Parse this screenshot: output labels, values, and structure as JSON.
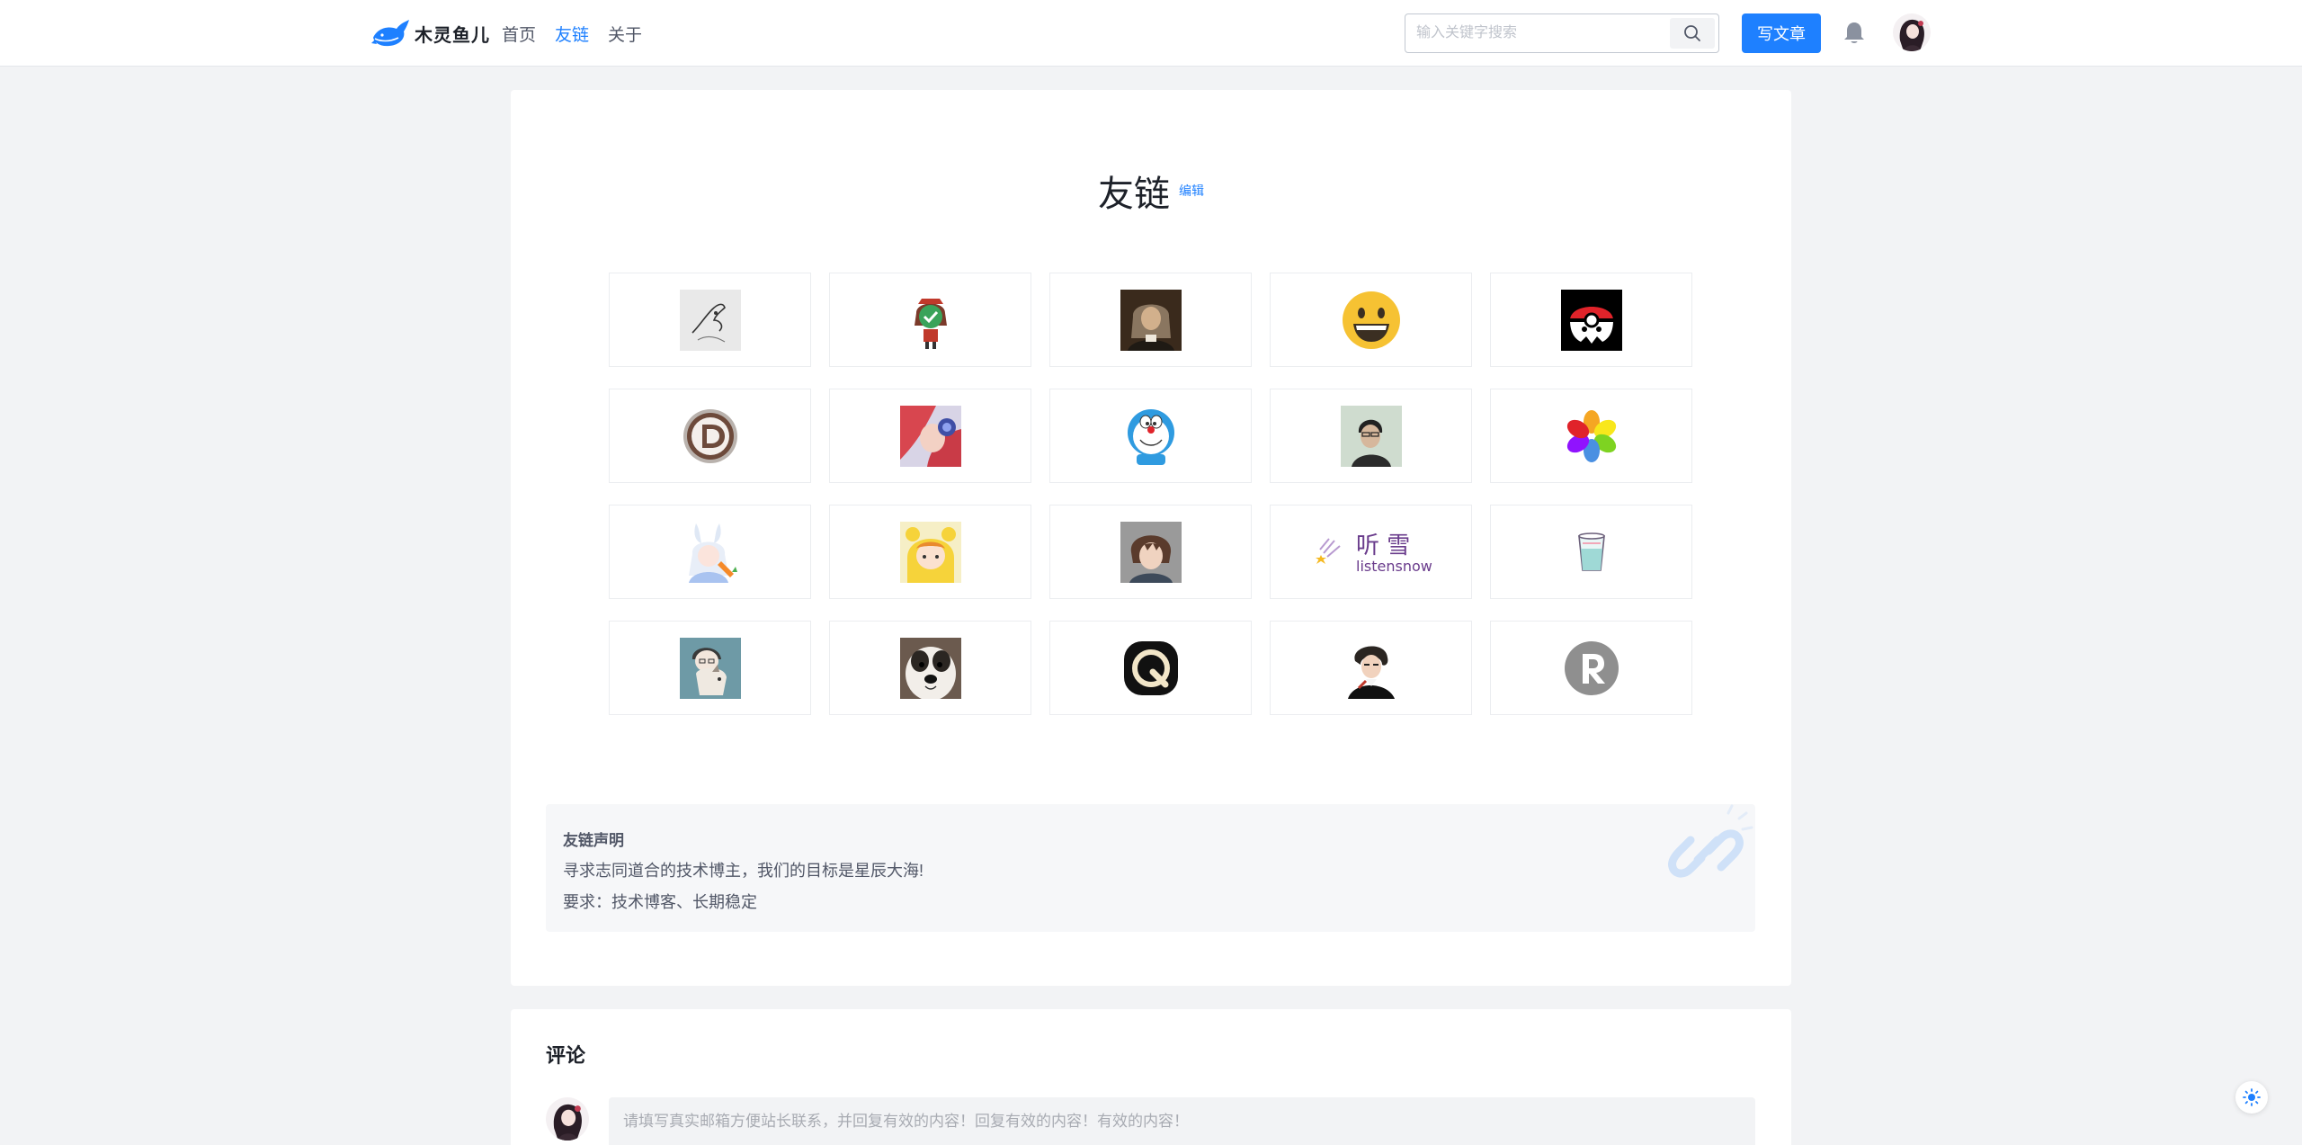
{
  "site": {
    "logo_text": "木灵鱼儿"
  },
  "nav": {
    "items": [
      "首页",
      "友链",
      "关于"
    ],
    "active_index": 1
  },
  "search": {
    "placeholder": "输入关键字搜索"
  },
  "header": {
    "write_label": "写文章"
  },
  "page": {
    "title": "友链",
    "edit_label": "编辑"
  },
  "friend_links": [
    {
      "icon": "sketch-avatar"
    },
    {
      "icon": "green-face-girl-avatar"
    },
    {
      "icon": "portrait-painting-avatar"
    },
    {
      "icon": "grinning-emoji-avatar"
    },
    {
      "icon": "pokeball-ghost-avatar"
    },
    {
      "icon": "d-letter-logo-avatar"
    },
    {
      "icon": "anime-red-hair-avatar"
    },
    {
      "icon": "doraemon-avatar"
    },
    {
      "icon": "man-photo-avatar"
    },
    {
      "icon": "color-pinwheel-avatar"
    },
    {
      "icon": "bunny-girl-avatar"
    },
    {
      "icon": "yellow-hood-avatar"
    },
    {
      "icon": "anime-boy-avatar"
    },
    {
      "icon": "listensnow-logo",
      "text_cn": "听 雪",
      "text_en": "listensnow"
    },
    {
      "icon": "water-cup-avatar"
    },
    {
      "icon": "cat-hug-avatar"
    },
    {
      "icon": "dog-photo-avatar"
    },
    {
      "icon": "q-letter-logo-avatar"
    },
    {
      "icon": "curly-hair-man-avatar"
    },
    {
      "icon": "r-letter-logo-avatar"
    }
  ],
  "statement": {
    "title": "友链声明",
    "line1": "寻求志同道合的技术博主，我们的目标是星辰大海!",
    "line2": "要求：技术博客、长期稳定"
  },
  "comments": {
    "title": "评论",
    "placeholder": "请填写真实邮箱方便站长联系，并回复有效的内容！回复有效的内容！有效的内容！"
  },
  "colors": {
    "accent": "#1e80ff",
    "page_bg": "#f2f3f5"
  }
}
